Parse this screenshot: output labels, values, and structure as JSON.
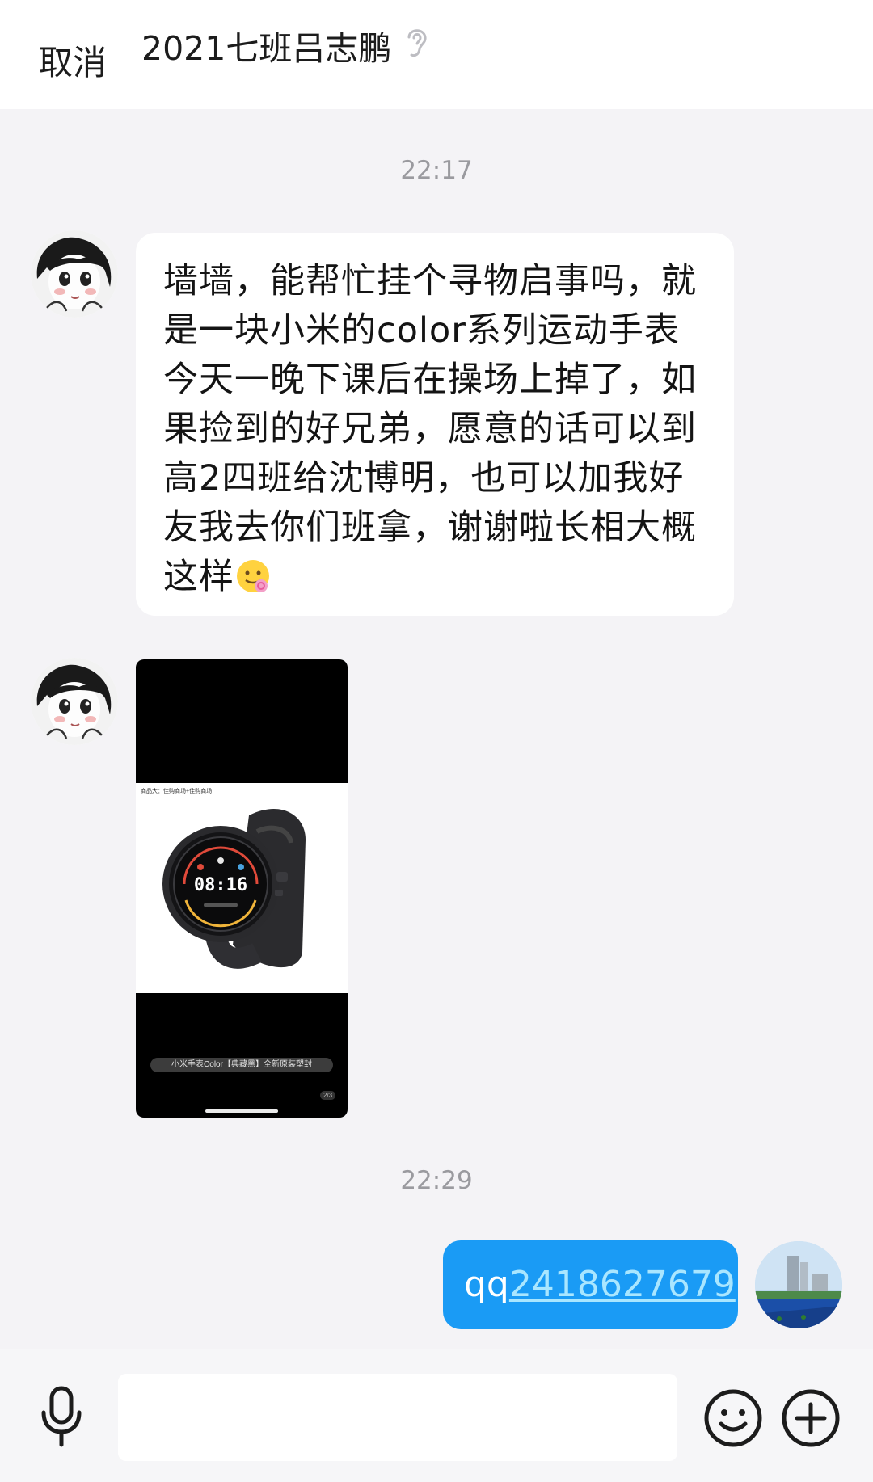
{
  "header": {
    "cancel_label": "取消",
    "chat_title": "2021七班吕志鹏"
  },
  "messages": [
    {
      "timestamp": "22:17",
      "text": "墙墙，能帮忙挂个寻物启事吗，就是一块小米的color系列运动手表今天一晚下课后在操场上掉了，如果捡到的好兄弟，愿意的话可以到高2四班给沈博明，也可以加我好友我去你们班拿，谢谢啦长相大概这样",
      "emoji": "drooling-face-emoji"
    },
    {
      "image": {
        "caption_small": "商品大：佳购商场+佳购商场",
        "watch_time": "08:16",
        "product_title": "小米手表Color【典藏黑】全新原装塑封",
        "page_indicator": "2/3"
      }
    },
    {
      "timestamp": "22:29",
      "outgoing_prefix": "qq",
      "outgoing_number": "2418627679"
    }
  ],
  "input": {
    "placeholder": "",
    "value": ""
  },
  "icons": {
    "header_ear": "ear-icon",
    "mic": "microphone-icon",
    "emoji": "smile-icon",
    "more": "plus-circle-icon"
  },
  "colors": {
    "background": "#f4f3f6",
    "outgoing_bubble": "#1a9bf5",
    "link": "#a9e6ff"
  }
}
